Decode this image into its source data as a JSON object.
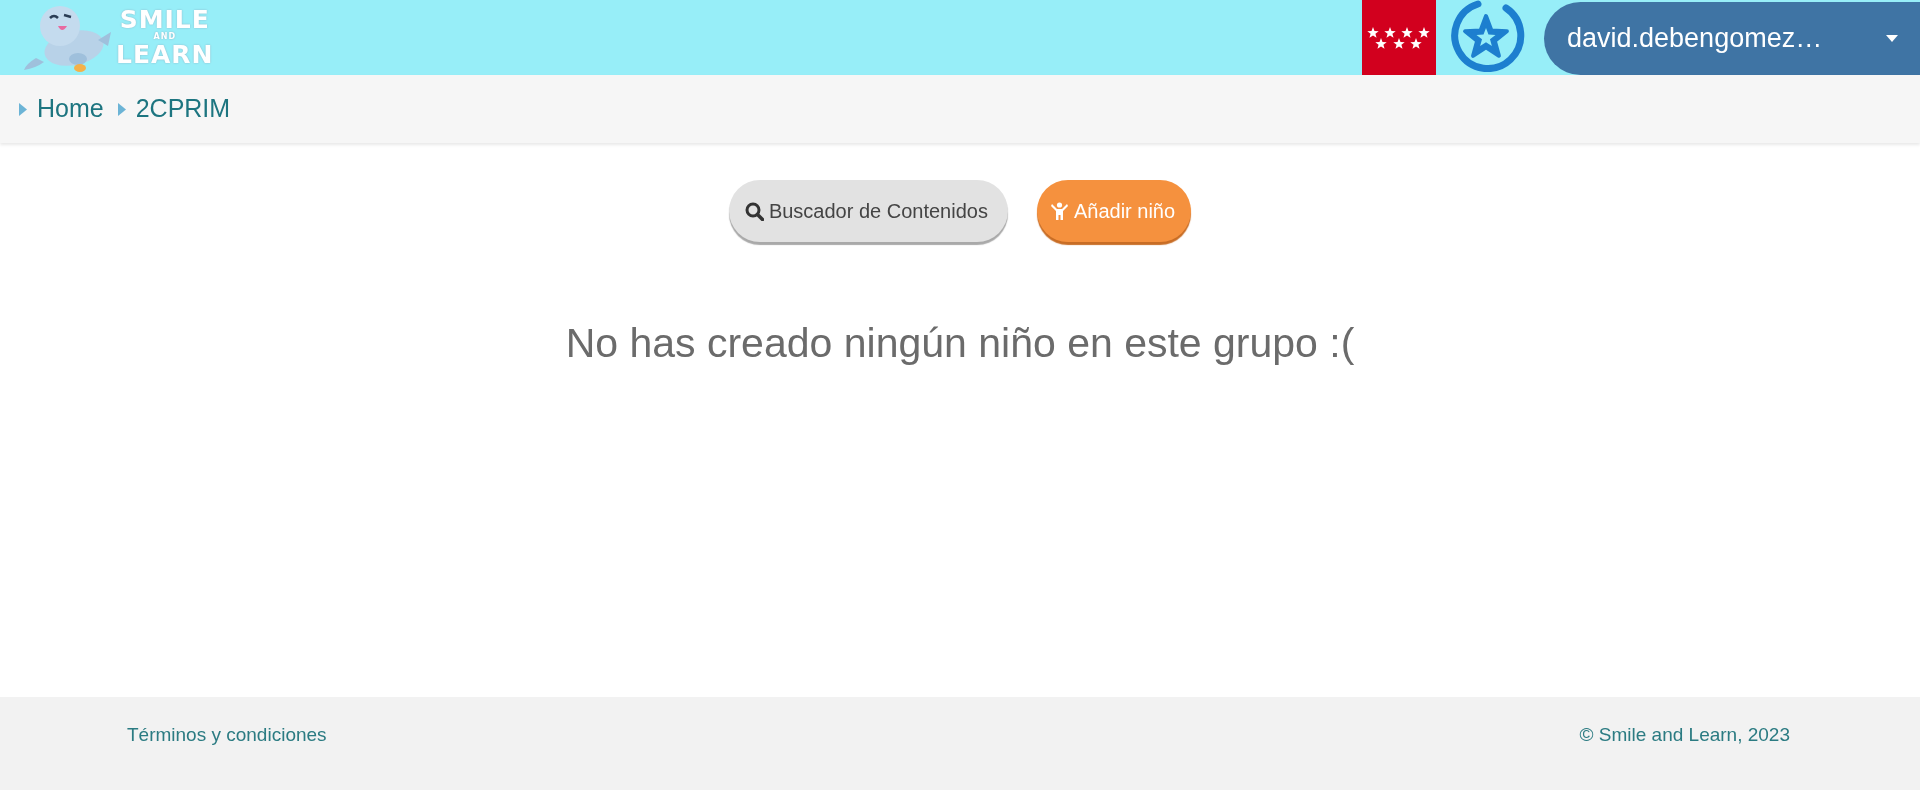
{
  "header": {
    "logo": {
      "lines": [
        "SMILE",
        "AND",
        "LEARN"
      ]
    },
    "user_menu": {
      "label": "david.debengomez…"
    }
  },
  "breadcrumb": [
    {
      "label": "Home"
    },
    {
      "label": "2CPRIM"
    }
  ],
  "actions": [
    {
      "kind": "search",
      "label": "Buscador de Contenidos"
    },
    {
      "kind": "add",
      "label": "Añadir niño"
    }
  ],
  "empty_message": "No has creado ningún niño en este grupo :(",
  "footer": {
    "terms_link": "Términos y condiciones",
    "copyright": "© Smile and Learn, 2023"
  }
}
